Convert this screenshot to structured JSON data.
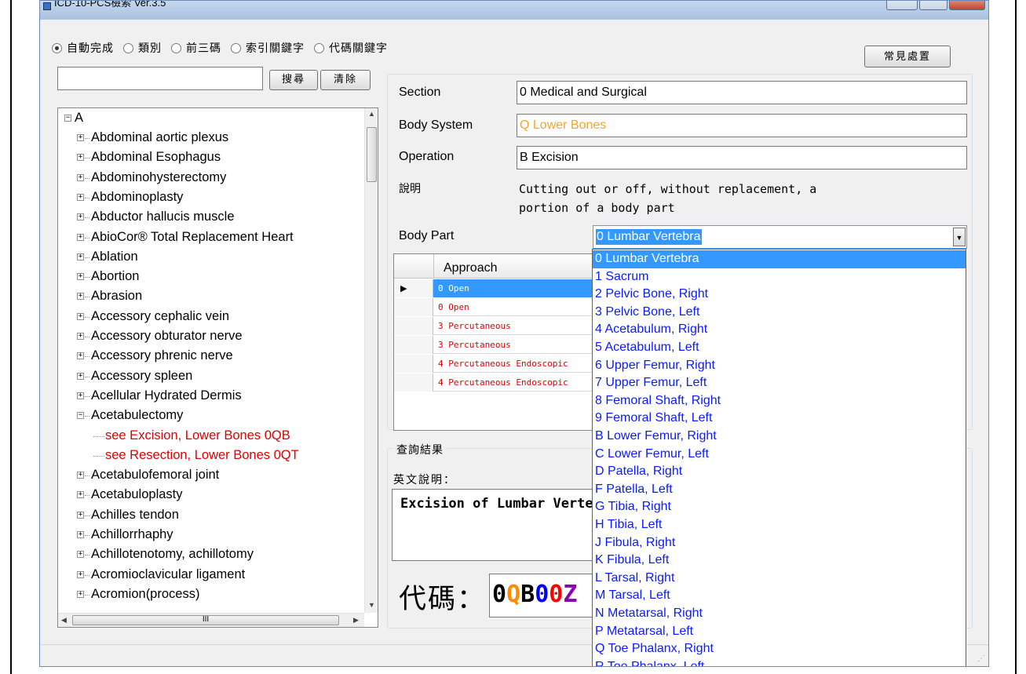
{
  "window": {
    "title": "ICD-10-PCS檢索 Ver.3.5"
  },
  "search_modes": [
    {
      "label": "自動完成",
      "selected": true
    },
    {
      "label": "類別",
      "selected": false
    },
    {
      "label": "前三碼",
      "selected": false
    },
    {
      "label": "索引關鍵字",
      "selected": false
    },
    {
      "label": "代碼關鍵字",
      "selected": false
    }
  ],
  "common_procedures_button": "常見處置",
  "search": {
    "value": "",
    "search_button": "搜尋",
    "clear_button": "清除"
  },
  "tree": {
    "root": "A",
    "items": [
      {
        "label": "Abdominal aortic plexus",
        "toggle": "+"
      },
      {
        "label": "Abdominal Esophagus",
        "toggle": "+"
      },
      {
        "label": "Abdominohysterectomy",
        "toggle": "+"
      },
      {
        "label": "Abdominoplasty",
        "toggle": "+"
      },
      {
        "label": "Abductor hallucis muscle",
        "toggle": "+"
      },
      {
        "label": "AbioCor® Total Replacement Heart",
        "toggle": "+"
      },
      {
        "label": "Ablation",
        "toggle": "+"
      },
      {
        "label": "Abortion",
        "toggle": "+"
      },
      {
        "label": "Abrasion",
        "toggle": "+"
      },
      {
        "label": "Accessory cephalic vein",
        "toggle": "+"
      },
      {
        "label": "Accessory obturator nerve",
        "toggle": "+"
      },
      {
        "label": "Accessory phrenic nerve",
        "toggle": "+"
      },
      {
        "label": "Accessory spleen",
        "toggle": "+"
      },
      {
        "label": "Acellular Hydrated Dermis",
        "toggle": "+"
      },
      {
        "label": "Acetabulectomy",
        "toggle": "-"
      },
      {
        "label": "see Excision, Lower Bones 0QB",
        "child": true
      },
      {
        "label": "see Resection, Lower Bones 0QT",
        "child": true
      },
      {
        "label": "Acetabulofemoral joint",
        "toggle": "+"
      },
      {
        "label": "Acetabuloplasty",
        "toggle": "+"
      },
      {
        "label": "Achilles tendon",
        "toggle": "+"
      },
      {
        "label": "Achillorrhaphy",
        "toggle": "+"
      },
      {
        "label": "Achillotenotomy, achillotomy",
        "toggle": "+"
      },
      {
        "label": "Acromioclavicular ligament",
        "toggle": "+"
      },
      {
        "label": "Acromion(process)",
        "toggle": "+"
      }
    ],
    "hscroll_thumb_label": "III"
  },
  "details": {
    "section_label": "Section",
    "section_value": "0 Medical and Surgical",
    "body_system_label": "Body System",
    "body_system_value": "Q Lower Bones",
    "operation_label": "Operation",
    "operation_value": "B Excision",
    "description_label": "說明",
    "description_text": "Cutting out or off, without replacement, a\nportion of a body part",
    "body_part_label": "Body Part",
    "body_part_value": "0 Lumbar Vertebra"
  },
  "approach_grid": {
    "header": "Approach",
    "rows": [
      {
        "value": "0 Open",
        "selected": true
      },
      {
        "value": "0 Open",
        "selected": false
      },
      {
        "value": "3 Percutaneous",
        "selected": false
      },
      {
        "value": "3 Percutaneous",
        "selected": false
      },
      {
        "value": "4 Percutaneous Endoscopic",
        "selected": false
      },
      {
        "value": "4 Percutaneous Endoscopic",
        "selected": false
      }
    ]
  },
  "results": {
    "title": "查詢結果",
    "english_label": "英文說明：",
    "english_text": "Excision of Lumbar Vertebra",
    "code_label": "代碼：",
    "code_chars": [
      {
        "ch": "0",
        "color": "#000000"
      },
      {
        "ch": "Q",
        "color": "#ff8c00"
      },
      {
        "ch": "B",
        "color": "#000000"
      },
      {
        "ch": "0",
        "color": "#0000ff"
      },
      {
        "ch": "0",
        "color": "#ff0000"
      },
      {
        "ch": "Z",
        "color": "#8b00b0"
      }
    ]
  },
  "dropdown": {
    "options": [
      "0 Lumbar Vertebra",
      "1 Sacrum",
      "2 Pelvic Bone, Right",
      "3 Pelvic Bone, Left",
      "4 Acetabulum, Right",
      "5 Acetabulum, Left",
      "6 Upper Femur, Right",
      "7 Upper Femur, Left",
      "8 Femoral Shaft, Right",
      "9 Femoral Shaft, Left",
      "B Lower Femur, Right",
      "C Lower Femur, Left",
      "D Patella, Right",
      "F Patella, Left",
      "G Tibia, Right",
      "H Tibia, Left",
      "J Fibula, Right",
      "K Fibula, Left",
      "L Tarsal, Right",
      "M Tarsal, Left",
      "N Metatarsal, Right",
      "P Metatarsal, Left",
      "Q Toe Phalanx, Right",
      "R Toe Phalanx, Left"
    ],
    "selected_index": 0
  },
  "colors": {
    "accent": "#3399ff",
    "body_system_text": "#f5a623",
    "tree_link": "#e00000",
    "dropdown_text": "#0a1aff"
  }
}
